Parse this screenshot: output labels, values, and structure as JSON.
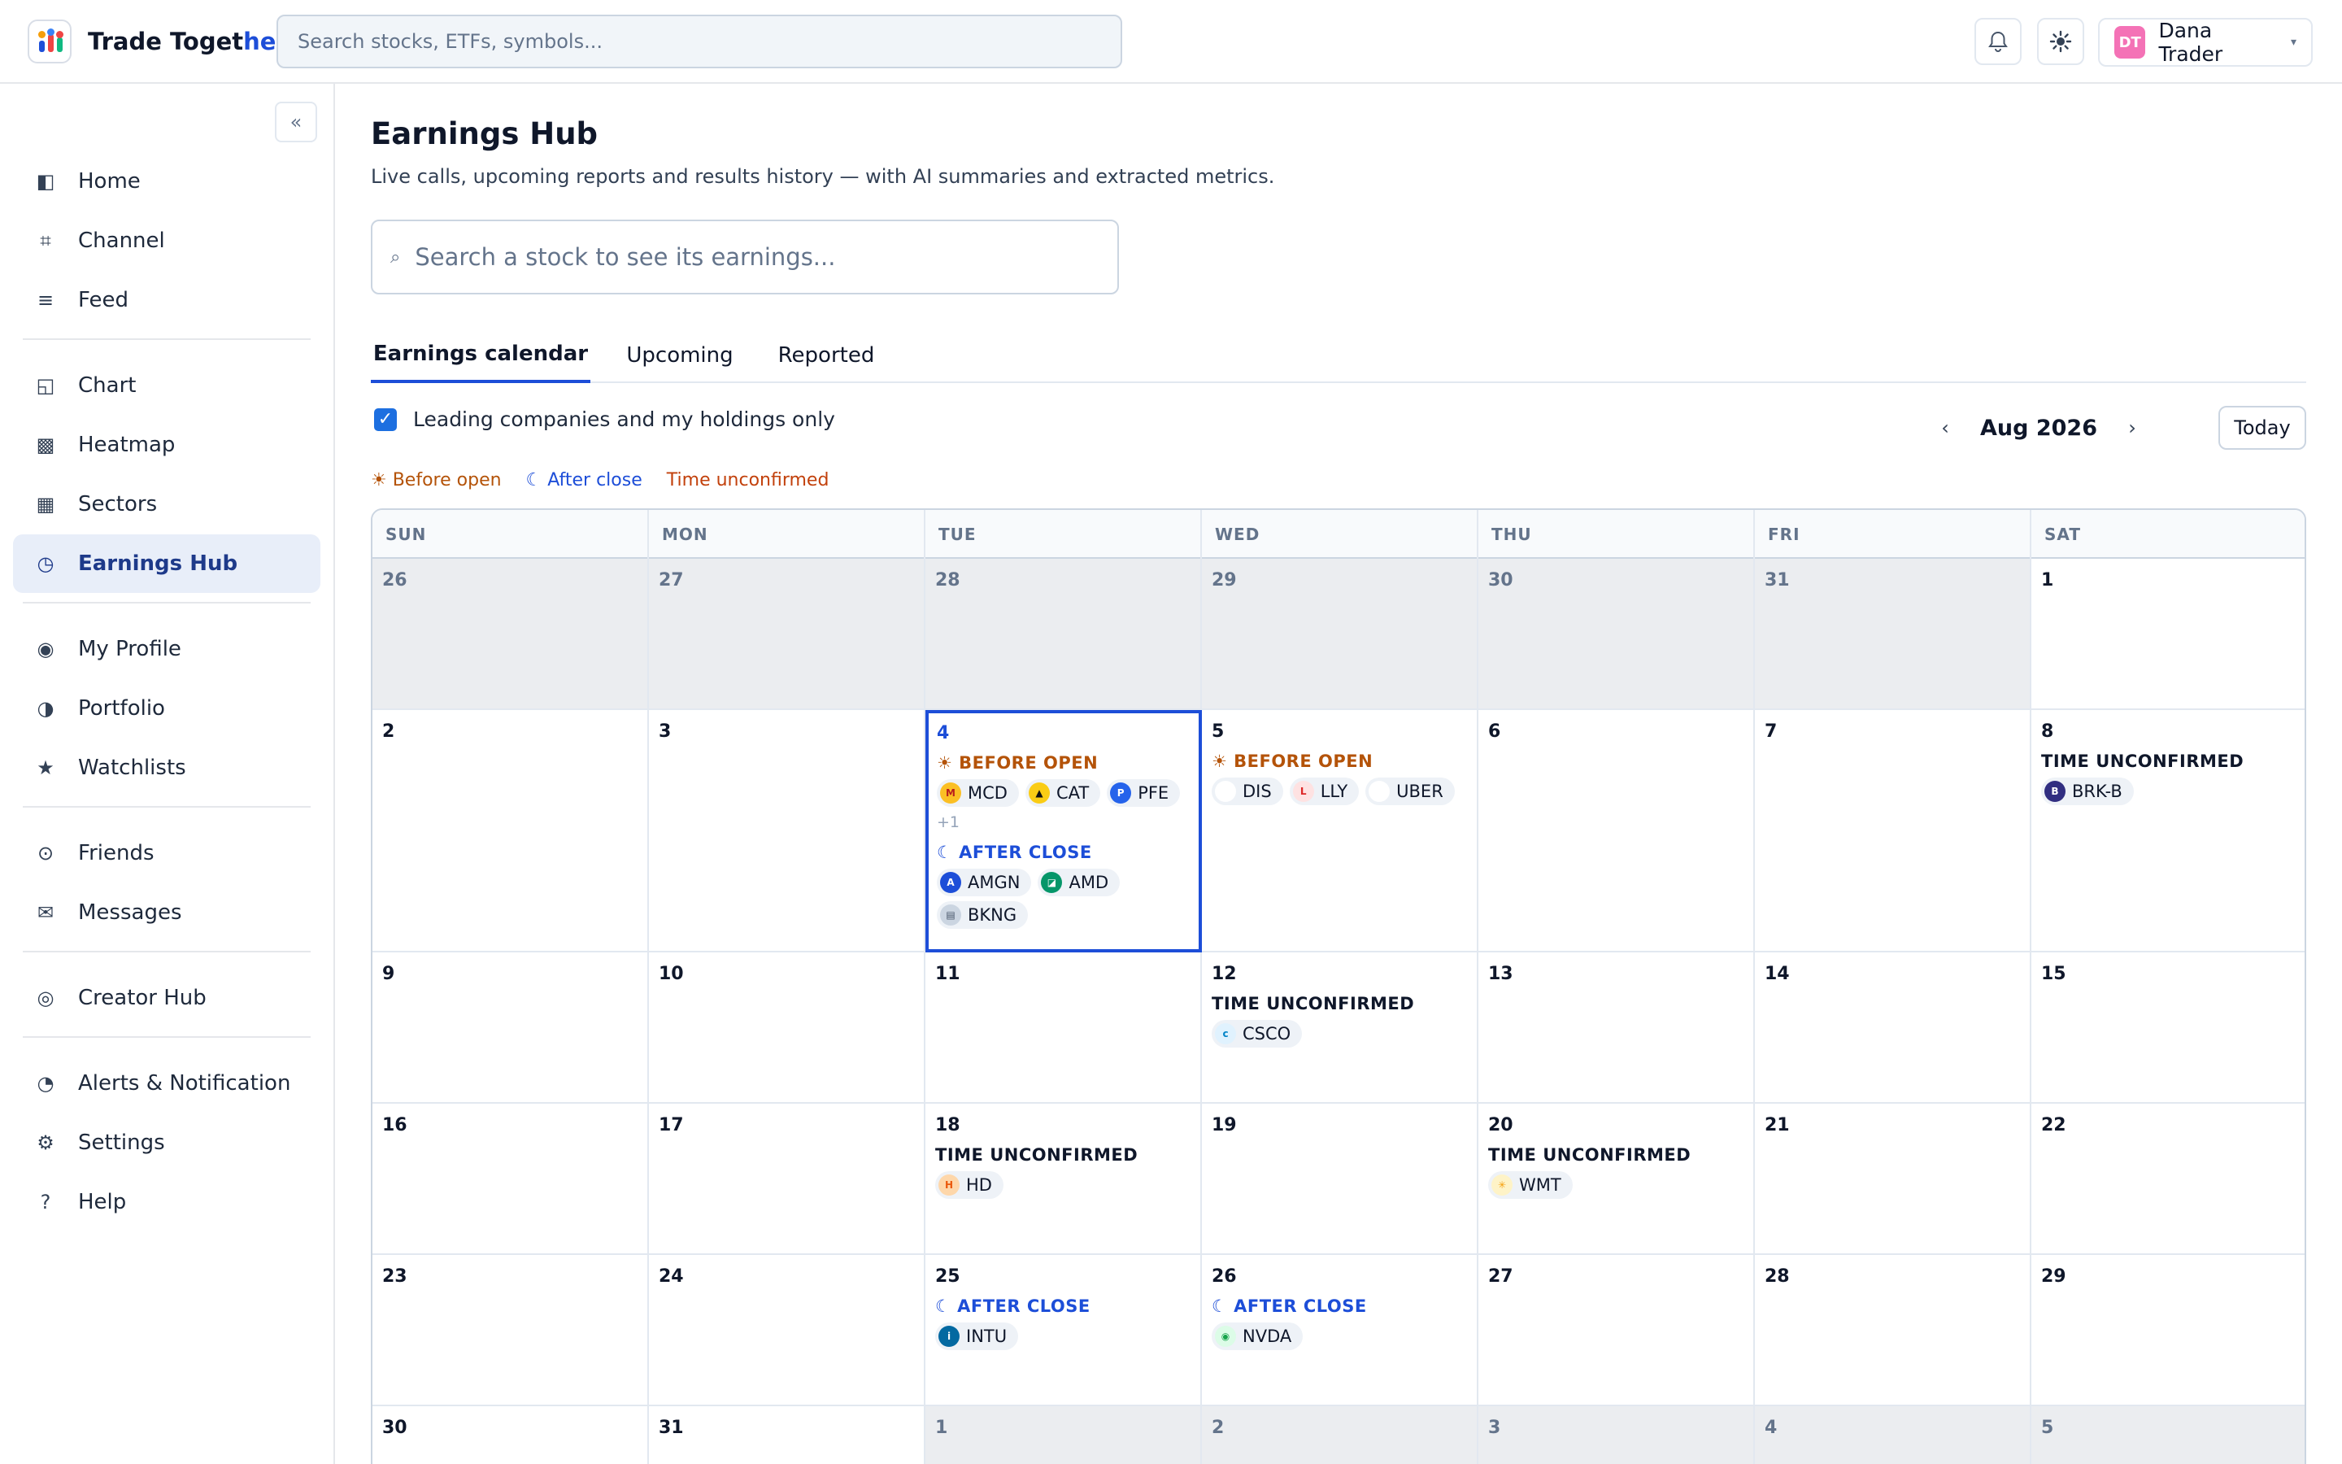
{
  "app": {
    "brand_part1": "Trade Toget",
    "brand_part2": "her",
    "search_placeholder": "Search stocks, ETFs, symbols...",
    "user_initials": "DT",
    "user_name": "Dana Trader"
  },
  "sidebar": {
    "collapse_label": "«",
    "items": [
      {
        "label": "Home",
        "icon": "◧",
        "icon_name": "home-icon"
      },
      {
        "label": "Channel",
        "icon": "⌗",
        "icon_name": "hash-icon"
      },
      {
        "label": "Feed",
        "icon": "≡",
        "icon_name": "feed-icon"
      },
      {
        "label": "Chart",
        "icon": "◱",
        "icon_name": "chart-icon"
      },
      {
        "label": "Heatmap",
        "icon": "▩",
        "icon_name": "heatmap-icon"
      },
      {
        "label": "Sectors",
        "icon": "▦",
        "icon_name": "sectors-icon"
      },
      {
        "label": "Earnings Hub",
        "icon": "◷",
        "icon_name": "earnings-icon"
      },
      {
        "label": "My Profile",
        "icon": "◉",
        "icon_name": "profile-icon"
      },
      {
        "label": "Portfolio",
        "icon": "◑",
        "icon_name": "portfolio-icon"
      },
      {
        "label": "Watchlists",
        "icon": "★",
        "icon_name": "star-icon"
      },
      {
        "label": "Friends",
        "icon": "⊙",
        "icon_name": "friends-icon"
      },
      {
        "label": "Messages",
        "icon": "✉",
        "icon_name": "mail-icon"
      },
      {
        "label": "Creator Hub",
        "icon": "◎",
        "icon_name": "creator-icon"
      },
      {
        "label": "Alerts & Notification",
        "icon": "◔",
        "icon_name": "alerts-icon"
      },
      {
        "label": "Settings",
        "icon": "⚙",
        "icon_name": "gear-icon"
      },
      {
        "label": "Help",
        "icon": "?",
        "icon_name": "help-icon"
      }
    ]
  },
  "main": {
    "title": "Earnings Hub",
    "subtitle": "Live calls, upcoming reports and results history — with AI summaries and extracted metrics.",
    "search_placeholder": "Search a stock to see its earnings...",
    "tabs": [
      "Earnings calendar",
      "Upcoming",
      "Reported"
    ],
    "filter_label": "Leading companies and my holdings only",
    "month": "Aug 2026",
    "today_label": "Today",
    "legend": {
      "before": "☀ Before open",
      "after": "☾ After close",
      "unconfirmed": "Time unconfirmed"
    }
  },
  "calendar": {
    "weekdays": [
      "SUN",
      "MON",
      "TUE",
      "WED",
      "THU",
      "FRI",
      "SAT"
    ],
    "labels": {
      "before": "☀ BEFORE OPEN",
      "after": "☾ AFTER CLOSE",
      "unconfirmed": "TIME UNCONFIRMED"
    },
    "weeks": [
      [
        {
          "day": "26",
          "other": true
        },
        {
          "day": "27",
          "other": true
        },
        {
          "day": "28",
          "other": true
        },
        {
          "day": "29",
          "other": true
        },
        {
          "day": "30",
          "other": true
        },
        {
          "day": "31",
          "other": true
        },
        {
          "day": "1"
        }
      ],
      [
        {
          "day": "2"
        },
        {
          "day": "3"
        },
        {
          "day": "4",
          "selected": true,
          "sessions": [
            {
              "type": "before",
              "tickers": [
                {
                  "symbol": "MCD",
                  "logo": "M",
                  "color": "#fbbf24",
                  "fg": "#b91c1c"
                },
                {
                  "symbol": "CAT",
                  "logo": "▲",
                  "color": "#facc15",
                  "fg": "#111"
                },
                {
                  "symbol": "PFE",
                  "logo": "P",
                  "color": "#2563eb",
                  "fg": "#fff"
                }
              ],
              "more": "+1"
            },
            {
              "type": "after",
              "tickers": [
                {
                  "symbol": "AMGN",
                  "logo": "A",
                  "color": "#1d4ed8",
                  "fg": "#fff"
                },
                {
                  "symbol": "AMD",
                  "logo": "◪",
                  "color": "#059669",
                  "fg": "#fff"
                },
                {
                  "symbol": "BKNG",
                  "logo": "▤",
                  "color": "#cbd5e1",
                  "fg": "#475569"
                }
              ]
            }
          ]
        },
        {
          "day": "5",
          "sessions": [
            {
              "type": "before",
              "tickers": [
                {
                  "symbol": "DIS",
                  "logo": "",
                  "color": "#ffffff",
                  "fg": "#000"
                },
                {
                  "symbol": "LLY",
                  "logo": "L",
                  "color": "#fee2e2",
                  "fg": "#dc2626"
                },
                {
                  "symbol": "UBER",
                  "logo": "",
                  "color": "#ffffff",
                  "fg": "#000"
                }
              ]
            }
          ]
        },
        {
          "day": "6"
        },
        {
          "day": "7"
        },
        {
          "day": "8",
          "sessions": [
            {
              "type": "unconfirmed",
              "tickers": [
                {
                  "symbol": "BRK-B",
                  "logo": "B",
                  "color": "#312e81",
                  "fg": "#fff"
                }
              ]
            }
          ]
        }
      ],
      [
        {
          "day": "9"
        },
        {
          "day": "10"
        },
        {
          "day": "11"
        },
        {
          "day": "12",
          "sessions": [
            {
              "type": "unconfirmed",
              "tickers": [
                {
                  "symbol": "CSCO",
                  "logo": "c",
                  "color": "#e0f2fe",
                  "fg": "#0284c7"
                }
              ]
            }
          ]
        },
        {
          "day": "13"
        },
        {
          "day": "14"
        },
        {
          "day": "15"
        }
      ],
      [
        {
          "day": "16"
        },
        {
          "day": "17"
        },
        {
          "day": "18",
          "sessions": [
            {
              "type": "unconfirmed",
              "tickers": [
                {
                  "symbol": "HD",
                  "logo": "H",
                  "color": "#fed7aa",
                  "fg": "#ea580c"
                }
              ]
            }
          ]
        },
        {
          "day": "19"
        },
        {
          "day": "20",
          "sessions": [
            {
              "type": "unconfirmed",
              "tickers": [
                {
                  "symbol": "WMT",
                  "logo": "✳",
                  "color": "#fef3c7",
                  "fg": "#f59e0b"
                }
              ]
            }
          ]
        },
        {
          "day": "21"
        },
        {
          "day": "22"
        }
      ],
      [
        {
          "day": "23"
        },
        {
          "day": "24"
        },
        {
          "day": "25",
          "sessions": [
            {
              "type": "after",
              "tickers": [
                {
                  "symbol": "INTU",
                  "logo": "i",
                  "color": "#0369a1",
                  "fg": "#fff"
                }
              ]
            }
          ]
        },
        {
          "day": "26",
          "sessions": [
            {
              "type": "after",
              "tickers": [
                {
                  "symbol": "NVDA",
                  "logo": "◉",
                  "color": "#dcfce7",
                  "fg": "#16a34a"
                }
              ]
            }
          ]
        },
        {
          "day": "27"
        },
        {
          "day": "28"
        },
        {
          "day": "29"
        }
      ],
      [
        {
          "day": "30"
        },
        {
          "day": "31"
        },
        {
          "day": "1",
          "other": true
        },
        {
          "day": "2",
          "other": true
        },
        {
          "day": "3",
          "other": true
        },
        {
          "day": "4",
          "other": true
        },
        {
          "day": "5",
          "other": true
        }
      ]
    ]
  },
  "colors": {
    "accent": "#1d4ed8",
    "before_open": "#b45309",
    "after_close": "#1d4ed8",
    "unconfirmed": "#ea580c"
  }
}
